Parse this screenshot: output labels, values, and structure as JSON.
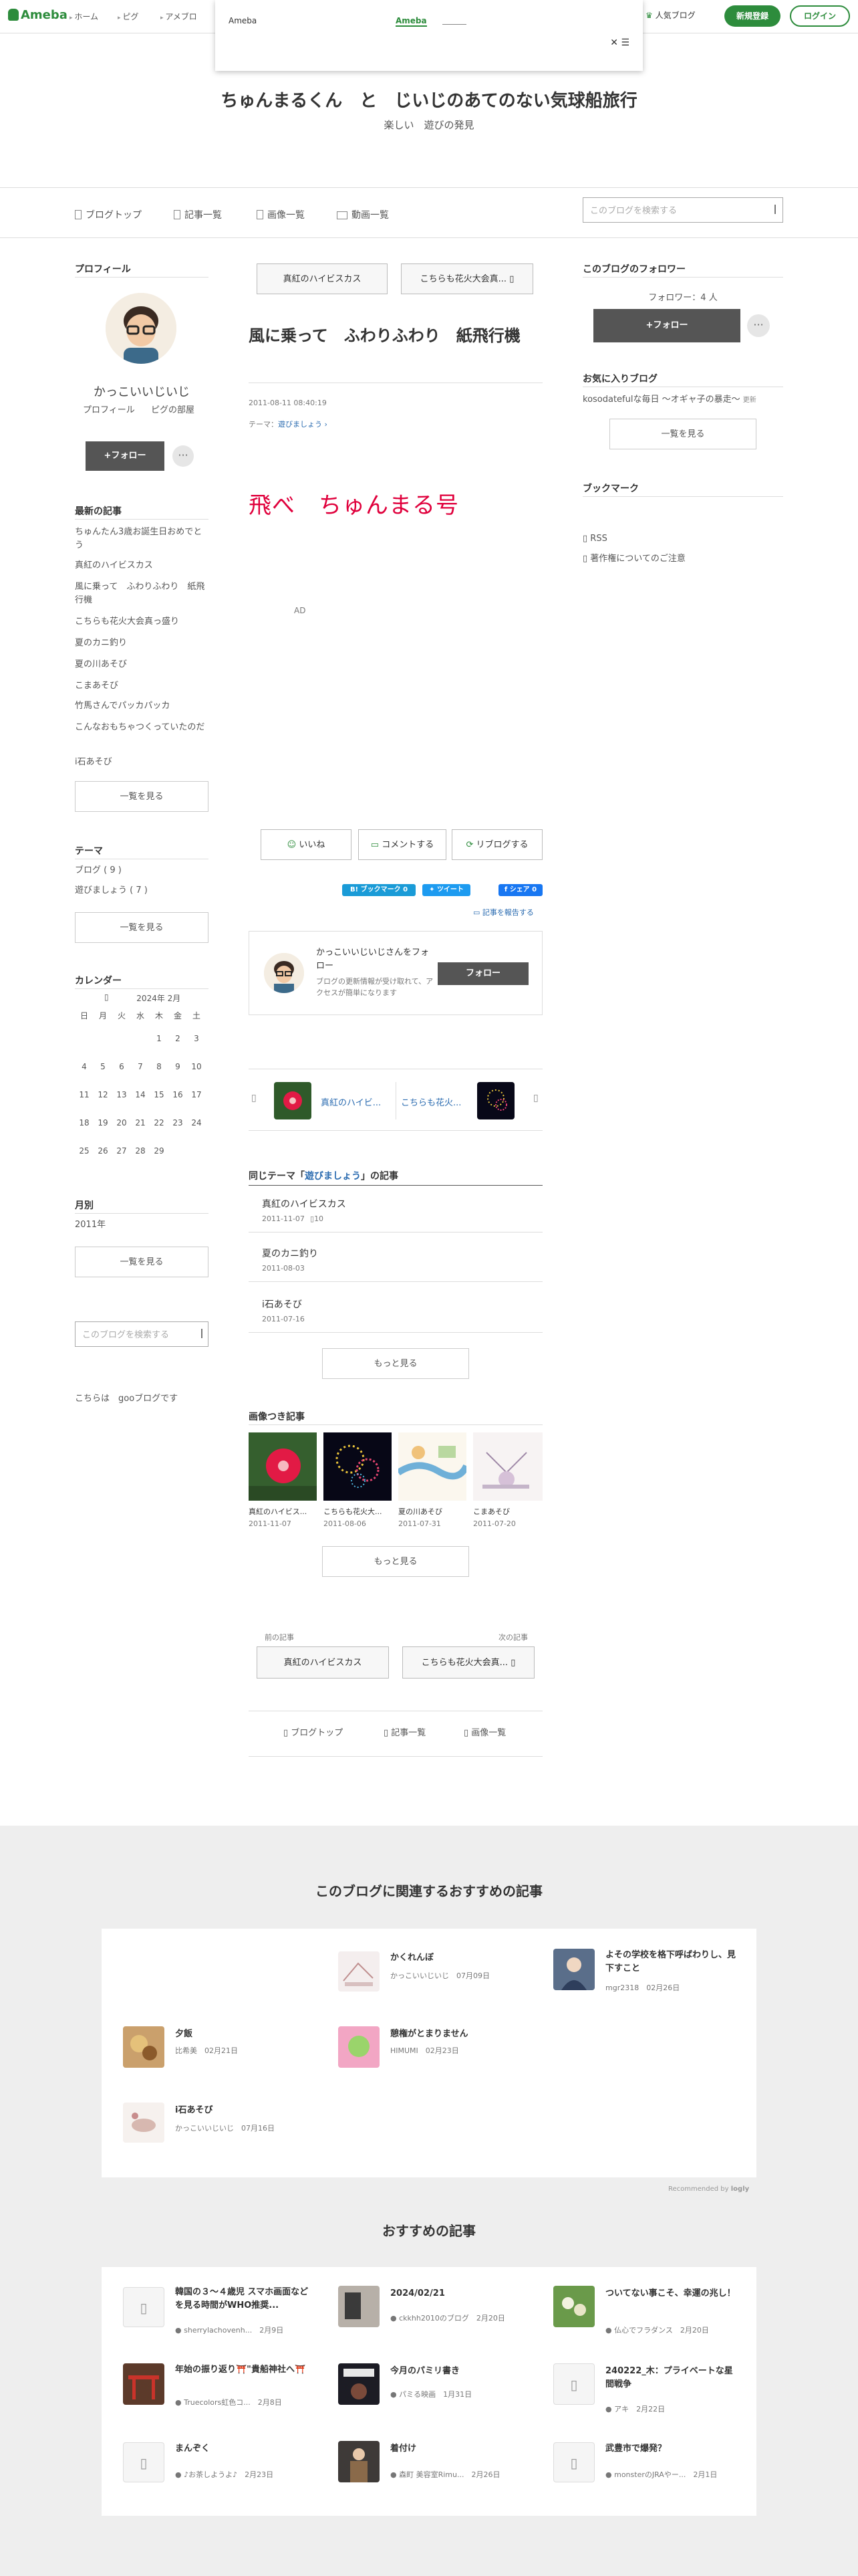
{
  "header": {
    "logo": "Ameba",
    "nav": [
      "ホーム",
      "ピグ",
      "アメブロ"
    ],
    "popup": {
      "label": "Ameba",
      "link": "Ameba",
      "close": "✕ ☰"
    },
    "popular_blog": "人気ブログ",
    "signup": "新規登録",
    "login": "ログイン"
  },
  "blog": {
    "title": "ちゅんまるくん　と　じいじのあてのない気球船旅行",
    "subtitle": "楽しい　遊びの発見"
  },
  "tabs": [
    "ブログトップ",
    "記事一覧",
    "画像一覧",
    "動画一覧"
  ],
  "search_placeholder": "このブログを検索する",
  "profile": {
    "heading": "プロフィール",
    "name": "かっこいいじいじ",
    "links": [
      "プロフィール",
      "ピグの部屋"
    ],
    "follow": "+フォロー",
    "dots": "···"
  },
  "recent": {
    "heading": "最新の記事",
    "items": [
      "ちゅんたん3歳お誕生日おめでとう",
      "真紅のハイビスカス",
      "風に乗って　ふわりふわり　紙飛行機",
      "こちらも花火大会真っ盛り",
      "夏のカニ釣り",
      "夏の川あそび",
      "こまあそび",
      "竹馬さんでパッカパッカ",
      "こんなおもちゃつくっていたのだ",
      "i石あそび"
    ],
    "more": "一覧を見る"
  },
  "theme": {
    "heading": "テーマ",
    "items": [
      "ブログ ( 9 )",
      "遊びましょう ( 7 )"
    ],
    "more": "一覧を見る"
  },
  "calendar": {
    "heading": "カレンダー",
    "month": "2024年 2月",
    "weekdays": [
      "日",
      "月",
      "火",
      "水",
      "木",
      "金",
      "土"
    ],
    "weeks": [
      [
        "",
        "",
        "",
        "",
        "1",
        "2",
        "3"
      ],
      [
        "4",
        "5",
        "6",
        "7",
        "8",
        "9",
        "10"
      ],
      [
        "11",
        "12",
        "13",
        "14",
        "15",
        "16",
        "17"
      ],
      [
        "18",
        "19",
        "20",
        "21",
        "22",
        "23",
        "24"
      ],
      [
        "25",
        "26",
        "27",
        "28",
        "29",
        "",
        ""
      ]
    ]
  },
  "monthly": {
    "heading": "月別",
    "items": [
      "2011年"
    ],
    "more": "一覧を見る"
  },
  "goo_note": "こちらは　gooブログです",
  "followers": {
    "heading": "このブログのフォロワー",
    "count": "フォロワー：4 人",
    "follow": "+フォロー",
    "dots": "···"
  },
  "favorites": {
    "heading": "お気に入りブログ",
    "items": [
      "kosodatefulな毎日 ～オギャ子の暴走～"
    ],
    "badge": "更新",
    "more": "一覧を見る"
  },
  "bookmark": {
    "heading": "ブックマーク",
    "items": [
      "RSS",
      "著作権についてのご注意"
    ]
  },
  "article": {
    "prev_top": "真紅のハイビスカス",
    "next_top": "こちらも花火大会真...",
    "title": "風に乗って　ふわりふわり　紙飛行機",
    "date": "2011-08-11 08:40:19",
    "theme_label": "テーマ：",
    "theme": "遊びましょう",
    "body": "飛べ　ちゅんまる号",
    "ad": "AD",
    "like": "いいね",
    "comment": "コメントする",
    "reblog": "リブログする",
    "hatena": "B! ブックマーク",
    "hatena_count": "0",
    "tweet": "ツイート",
    "fb": "シェア 0",
    "report": "記事を報告する",
    "follow_card_title": "かっこいいじいじさんをフォロー",
    "follow_card_desc": "ブログの更新情報が受け取れて、アクセスが簡単になります",
    "follow_card_btn": "フォロー"
  },
  "carousel": {
    "items": [
      {
        "label": "真紅のハイビ..."
      },
      {
        "label": "こちらも花火..."
      }
    ]
  },
  "same_theme": {
    "heading_prefix": "同じテーマ「",
    "theme": "遊びましょう",
    "heading_suffix": "」の記事",
    "items": [
      {
        "title": "真紅のハイビスカス",
        "date": "2011-11-07",
        "count": "10"
      },
      {
        "title": "夏のカニ釣り",
        "date": "2011-08-03",
        "count": ""
      },
      {
        "title": "i石あそび",
        "date": "2011-07-16",
        "count": ""
      }
    ],
    "more": "もっと見る"
  },
  "image_articles": {
    "heading": "画像つき記事",
    "items": [
      {
        "title": "真紅のハイビス...",
        "date": "2011-11-07"
      },
      {
        "title": "こちらも花火大...",
        "date": "2011-08-06"
      },
      {
        "title": "夏の川あそび",
        "date": "2011-07-31"
      },
      {
        "title": "こまあそび",
        "date": "2011-07-20"
      }
    ],
    "more": "もっと見る"
  },
  "bottom_nav": {
    "prev_label": "前の記事",
    "next_label": "次の記事",
    "prev": "真紅のハイビスカス",
    "next": "こちらも花火大会真...",
    "links": [
      "ブログトップ",
      "記事一覧",
      "画像一覧"
    ]
  },
  "related": {
    "heading": "このブログに関連するおすすめの記事",
    "items": [
      {
        "title": "かくれんぼ",
        "author": "かっこいいじいじ",
        "date": "07月09日"
      },
      {
        "title": "よその学校を格下呼ばわりし、見下すこと",
        "author": "mgr2318",
        "date": "02月26日"
      },
      {
        "title": "夕飯",
        "author": "比希美",
        "date": "02月21日"
      },
      {
        "title": "憩権がとまりません",
        "author": "HIMUMI",
        "date": "02月23日"
      },
      {
        "title": "i石あそび",
        "author": "かっこいいじいじ",
        "date": "07月16日"
      }
    ],
    "credit": "Recommended by",
    "credit_brand": "logly"
  },
  "recommend": {
    "heading": "おすすめの記事",
    "items": [
      {
        "title": "韓国の３～４歳児 スマホ画面などを見る時間がWHO推奨...",
        "author": "sherrylachovenh...",
        "date": "2月9日"
      },
      {
        "title": "2024/02/21",
        "author": "ckkhh2010のブログ",
        "date": "2月20日"
      },
      {
        "title": "ついてない事こそ、幸運の兆し！",
        "author": "仏心でフラダンス",
        "date": "2月20日"
      },
      {
        "title": "年始の振り返り⛩️\"貴船神社へ⛩️",
        "author": "Truecolors虹色コ...",
        "date": "2月8日"
      },
      {
        "title": "今月のパミリ書き",
        "author": "パミる映画",
        "date": "1月31日"
      },
      {
        "title": "240222_木：プライベートな星間戦争",
        "author": "アキ",
        "date": "2月22日"
      },
      {
        "title": "まんぞく",
        "author": "♪お茶しようよ♪",
        "date": "2月23日"
      },
      {
        "title": "着付け",
        "author": "森町 美容室Rimu...",
        "date": "2月26日"
      },
      {
        "title": "武豊市で爆発？",
        "author": "monsterのJRAやー...",
        "date": "2月1日"
      }
    ]
  },
  "colors": {
    "brand": "#2d8c3c",
    "accent_red": "#e0003c"
  }
}
